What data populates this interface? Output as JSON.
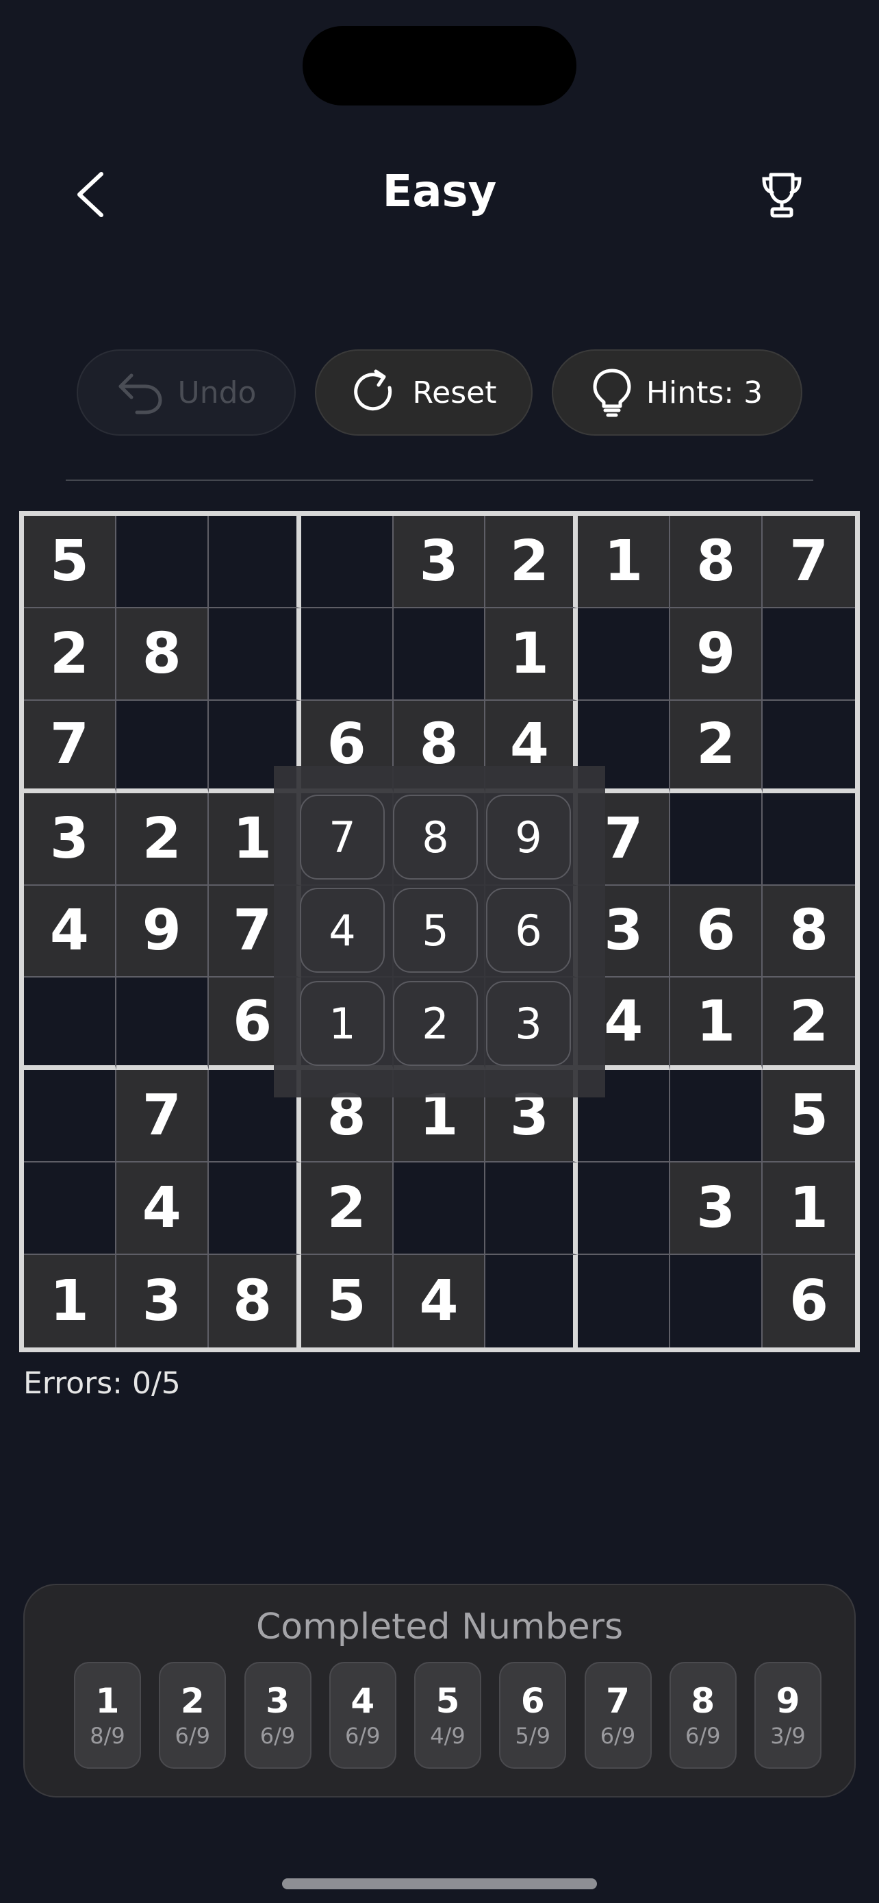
{
  "header": {
    "title": "Easy",
    "back_icon": "chevron-left-icon",
    "trophy_icon": "trophy-icon"
  },
  "toolbar": {
    "undo_label": "Undo",
    "reset_label": "Reset",
    "hints_label": "Hints: 3"
  },
  "board": {
    "rows": [
      [
        "5",
        "",
        "",
        "",
        "3",
        "2",
        "1",
        "8",
        "7"
      ],
      [
        "2",
        "8",
        "",
        "",
        "",
        "1",
        "",
        "9",
        ""
      ],
      [
        "7",
        "",
        "",
        "6",
        "8",
        "4",
        "",
        "2",
        ""
      ],
      [
        "3",
        "2",
        "1",
        "",
        "",
        "",
        "7",
        "",
        ""
      ],
      [
        "4",
        "9",
        "7",
        "",
        "",
        "",
        "3",
        "6",
        "8"
      ],
      [
        "",
        "",
        "6",
        "",
        "",
        "",
        "4",
        "1",
        "2"
      ],
      [
        "",
        "7",
        "",
        "8",
        "1",
        "3",
        "",
        "",
        "5"
      ],
      [
        "",
        "4",
        "",
        "2",
        "",
        "",
        "",
        "3",
        "1"
      ],
      [
        "1",
        "3",
        "8",
        "5",
        "4",
        "",
        "",
        "",
        "6"
      ]
    ]
  },
  "numpad": {
    "keys": [
      "7",
      "8",
      "9",
      "4",
      "5",
      "6",
      "1",
      "2",
      "3"
    ]
  },
  "status": {
    "errors": "Errors: 0/5"
  },
  "completed": {
    "title": "Completed Numbers",
    "items": [
      {
        "number": "1",
        "count": "8/9"
      },
      {
        "number": "2",
        "count": "6/9"
      },
      {
        "number": "3",
        "count": "6/9"
      },
      {
        "number": "4",
        "count": "6/9"
      },
      {
        "number": "5",
        "count": "4/9"
      },
      {
        "number": "6",
        "count": "5/9"
      },
      {
        "number": "7",
        "count": "6/9"
      },
      {
        "number": "8",
        "count": "6/9"
      },
      {
        "number": "9",
        "count": "3/9"
      }
    ]
  },
  "colors": {
    "background": "#141722",
    "given_cell": "#2e2e30",
    "box_border": "#d8d8d8"
  }
}
